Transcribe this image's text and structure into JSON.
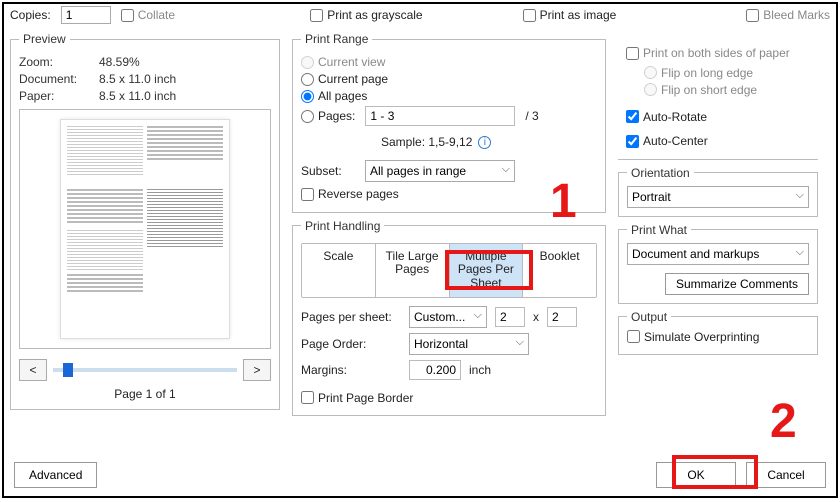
{
  "top": {
    "copies_label": "Copies:",
    "copies_value": "1",
    "collate": "Collate",
    "grayscale": "Print as grayscale",
    "as_image": "Print as image",
    "bleed": "Bleed Marks"
  },
  "preview": {
    "legend": "Preview",
    "zoom_label": "Zoom:",
    "zoom_value": "48.59%",
    "doc_label": "Document:",
    "doc_value": "8.5 x 11.0 inch",
    "paper_label": "Paper:",
    "paper_value": "8.5 x 11.0 inch",
    "page_status": "Page 1 of 1"
  },
  "range": {
    "legend": "Print Range",
    "current_view": "Current view",
    "current_page": "Current page",
    "all_pages": "All pages",
    "pages_label": "Pages:",
    "pages_value": "1 - 3",
    "pages_total": "/ 3",
    "sample_label": "Sample: 1,5-9,12",
    "subset_label": "Subset:",
    "subset_value": "All pages in range",
    "reverse": "Reverse pages"
  },
  "handling": {
    "legend": "Print Handling",
    "tabs": [
      "Scale",
      "Tile Large Pages",
      "Multiple Pages Per Sheet",
      "Booklet"
    ],
    "pps_label": "Pages per sheet:",
    "pps_mode": "Custom...",
    "pps_cols": "2",
    "pps_x": "x",
    "pps_rows": "2",
    "order_label": "Page Order:",
    "order_value": "Horizontal",
    "margins_label": "Margins:",
    "margins_value": "0.200",
    "margins_unit": "inch",
    "border": "Print Page Border"
  },
  "rightcol": {
    "both_sides": "Print on both sides of paper",
    "flip_long": "Flip on long edge",
    "flip_short": "Flip on short edge",
    "auto_rotate": "Auto-Rotate",
    "auto_center": "Auto-Center",
    "orientation_legend": "Orientation",
    "orientation_value": "Portrait",
    "print_what_legend": "Print What",
    "print_what_value": "Document and markups",
    "summarize": "Summarize Comments",
    "output_legend": "Output",
    "simulate": "Simulate Overprinting"
  },
  "buttons": {
    "advanced": "Advanced",
    "ok": "OK",
    "cancel": "Cancel",
    "prev": "<",
    "next": ">"
  },
  "annotations": {
    "num1": "1",
    "num2": "2"
  }
}
